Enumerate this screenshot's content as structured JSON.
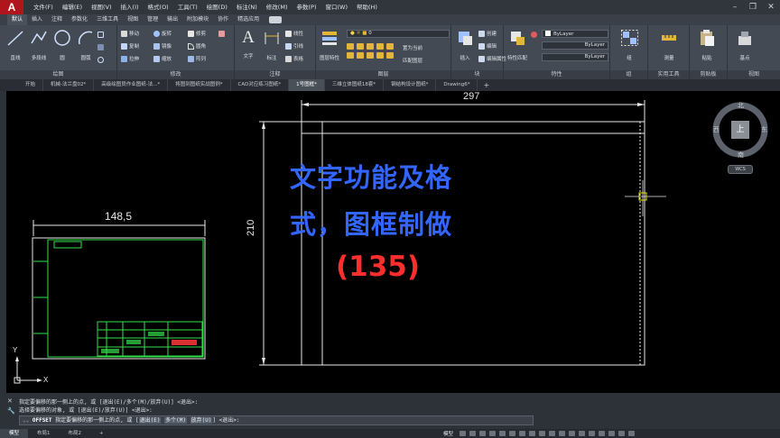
{
  "app": {
    "logo": "A"
  },
  "menu": [
    "文件(F)",
    "编辑(E)",
    "视图(V)",
    "插入(I)",
    "格式(O)",
    "工具(T)",
    "绘图(D)",
    "标注(N)",
    "修改(M)",
    "参数(P)",
    "窗口(W)",
    "帮助(H)"
  ],
  "ribbon_tabs": [
    {
      "label": "默认",
      "active": true
    },
    {
      "label": "插入"
    },
    {
      "label": "注释"
    },
    {
      "label": "参数化"
    },
    {
      "label": "三维工具"
    },
    {
      "label": "视图"
    },
    {
      "label": "管理"
    },
    {
      "label": "输出"
    },
    {
      "label": "附加模块"
    },
    {
      "label": "协作"
    },
    {
      "label": "精选应用"
    }
  ],
  "ribbon": {
    "draw": {
      "title": "绘图",
      "line": "直线",
      "polyline": "多段线",
      "circle": "圆",
      "arc": "圆弧"
    },
    "modify": {
      "title": "修改",
      "move": "移动",
      "rotate": "旋转",
      "trim": "修剪",
      "copy": "复制",
      "mirror": "镜像",
      "fillet": "圆角",
      "stretch": "拉伸",
      "scale": "缩放",
      "array": "阵列"
    },
    "annotation": {
      "title": "注释",
      "text": "文字",
      "dimension": "标注",
      "linear": "线性",
      "leader": "引线",
      "table": "表格"
    },
    "layers": {
      "title": "图层",
      "properties": "图层特性",
      "current_layer": "0",
      "make_current": "置为当前",
      "match": "匹配图层"
    },
    "block": {
      "title": "块",
      "insert": "插入",
      "create": "创建",
      "edit": "编辑",
      "edit_attr": "编辑属性"
    },
    "properties": {
      "title": "特性",
      "match": "特性匹配",
      "color": "ByLayer",
      "linetype": "ByLayer",
      "lineweight": "ByLayer"
    },
    "groups": {
      "title": "组",
      "group": "组"
    },
    "utilities": {
      "title": "实用工具",
      "measure": "测量"
    },
    "clipboard": {
      "title": "剪贴板",
      "paste": "粘贴"
    },
    "view": {
      "title": "视图",
      "base": "基点"
    }
  },
  "doc_tabs": [
    {
      "label": "开始"
    },
    {
      "label": "机械-法兰盘02*"
    },
    {
      "label": "高级绘图员作业图纸-法...*"
    },
    {
      "label": "将图到图纸实战图例*"
    },
    {
      "label": "CAD对应练习图纸*"
    },
    {
      "label": "1号图框*",
      "active": true
    },
    {
      "label": "三维立体图纸18套*"
    },
    {
      "label": "钢结构设计图纸*"
    },
    {
      "label": "Drawing6*"
    }
  ],
  "canvas": {
    "overlay_line_1": "文字功能及格",
    "overlay_line_2": "式，图框制做",
    "episode": "(135)",
    "dim_small_width": "148,5",
    "dim_width": "297",
    "dim_height": "210",
    "ucs_y": "Y",
    "ucs_x": "X",
    "colors": {
      "overlay_blue": "#3366ff",
      "overlay_red": "#ff2e2e",
      "frame_green": "#35e04a",
      "dimension": "#e8e8e8",
      "crosshair": "#e6e600"
    }
  },
  "viewcube": {
    "north": "北",
    "south": "南",
    "east": "东",
    "west": "西",
    "top": "上",
    "wcs": "WCS"
  },
  "command": {
    "history_1": "指定要偏移的那一侧上的点, 或 [退出(E)/多个(M)/放弃(U)] <退出>:",
    "history_2": "选择要偏移的对象, 或 [退出(E)/放弃(U)] <退出>:",
    "prefix": "OFFSET",
    "prompt": "指定要偏移的那一侧上的点, 或",
    "opt_exit": "退出(E)",
    "opt_multiple": "多个(M)",
    "opt_undo": "放弃(U)",
    "suffix": "<退出>:"
  },
  "layout_tabs": [
    {
      "label": "模型",
      "active": true
    },
    {
      "label": "布局1"
    },
    {
      "label": "布局2"
    },
    {
      "label": "+"
    }
  ],
  "status": {
    "model": "模型"
  }
}
